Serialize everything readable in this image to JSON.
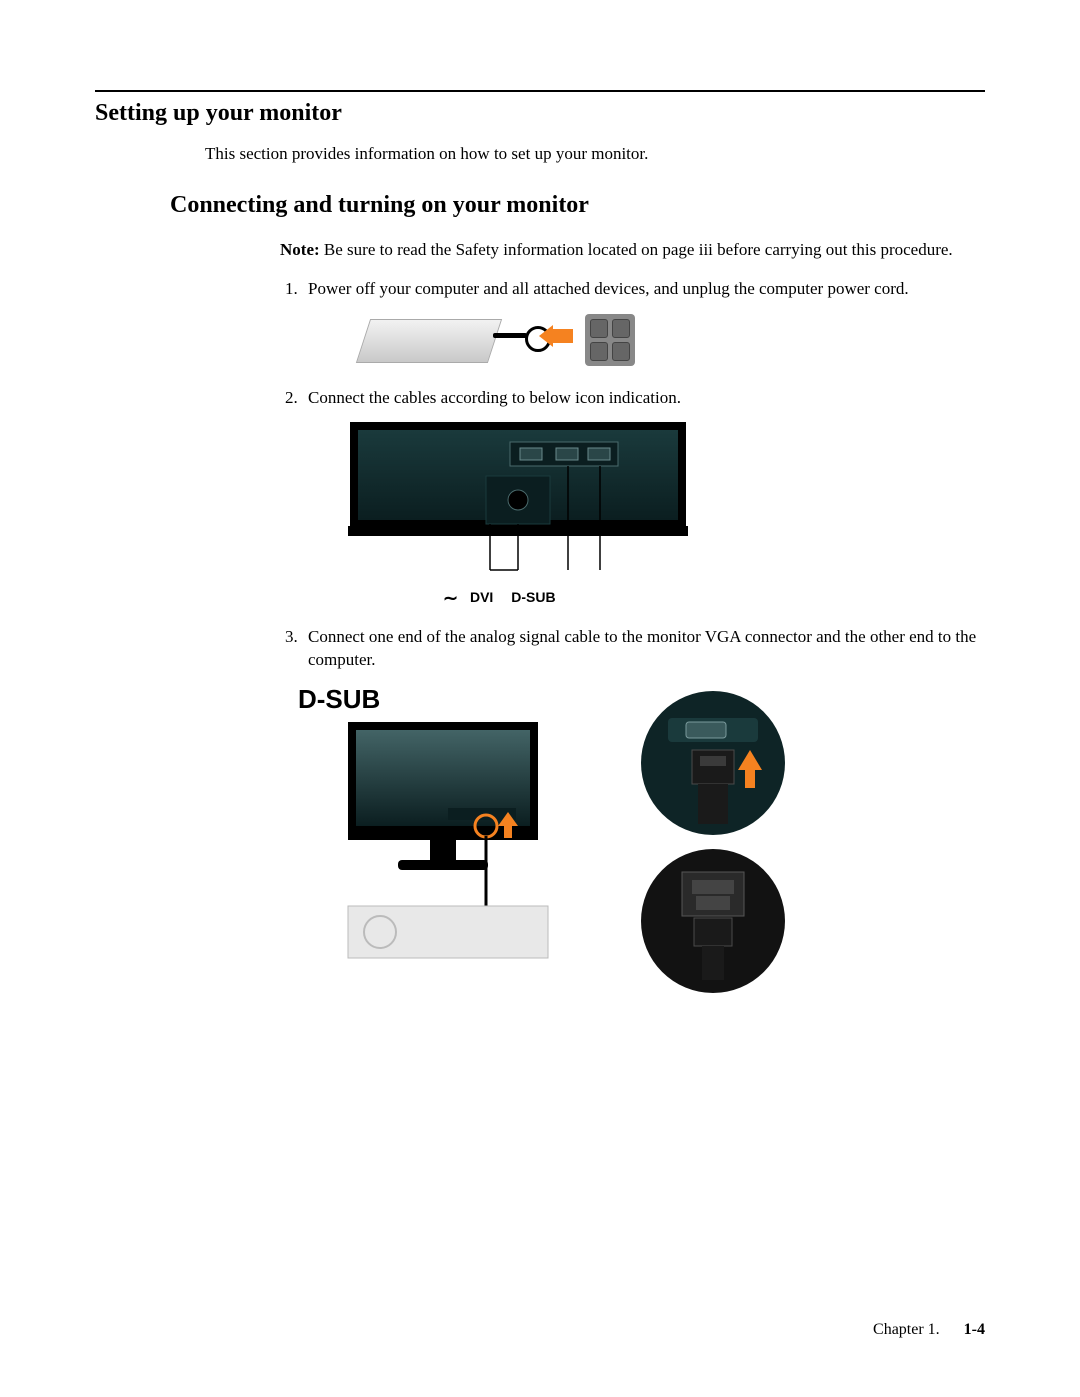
{
  "heading": "Setting up your monitor",
  "intro": "This section provides information on how to set up your monitor.",
  "subheading": "Connecting and turning on your monitor",
  "note_label": "Note:",
  "note_text": " Be sure to read the Safety information located on page iii before carrying out this procedure.",
  "steps": {
    "s1": "Power off your computer and all attached devices, and unplug the computer power cord.",
    "s2": "Connect the cables according to below icon indication.",
    "s3": "Connect one end of the analog signal cable to the monitor VGA connector and the other end to the computer."
  },
  "port_labels": {
    "ac": "∼",
    "dvi": "DVI",
    "dsub": "D-SUB"
  },
  "fig3_title": "D-SUB",
  "footer_chapter": "Chapter 1.",
  "footer_page": "1-4"
}
